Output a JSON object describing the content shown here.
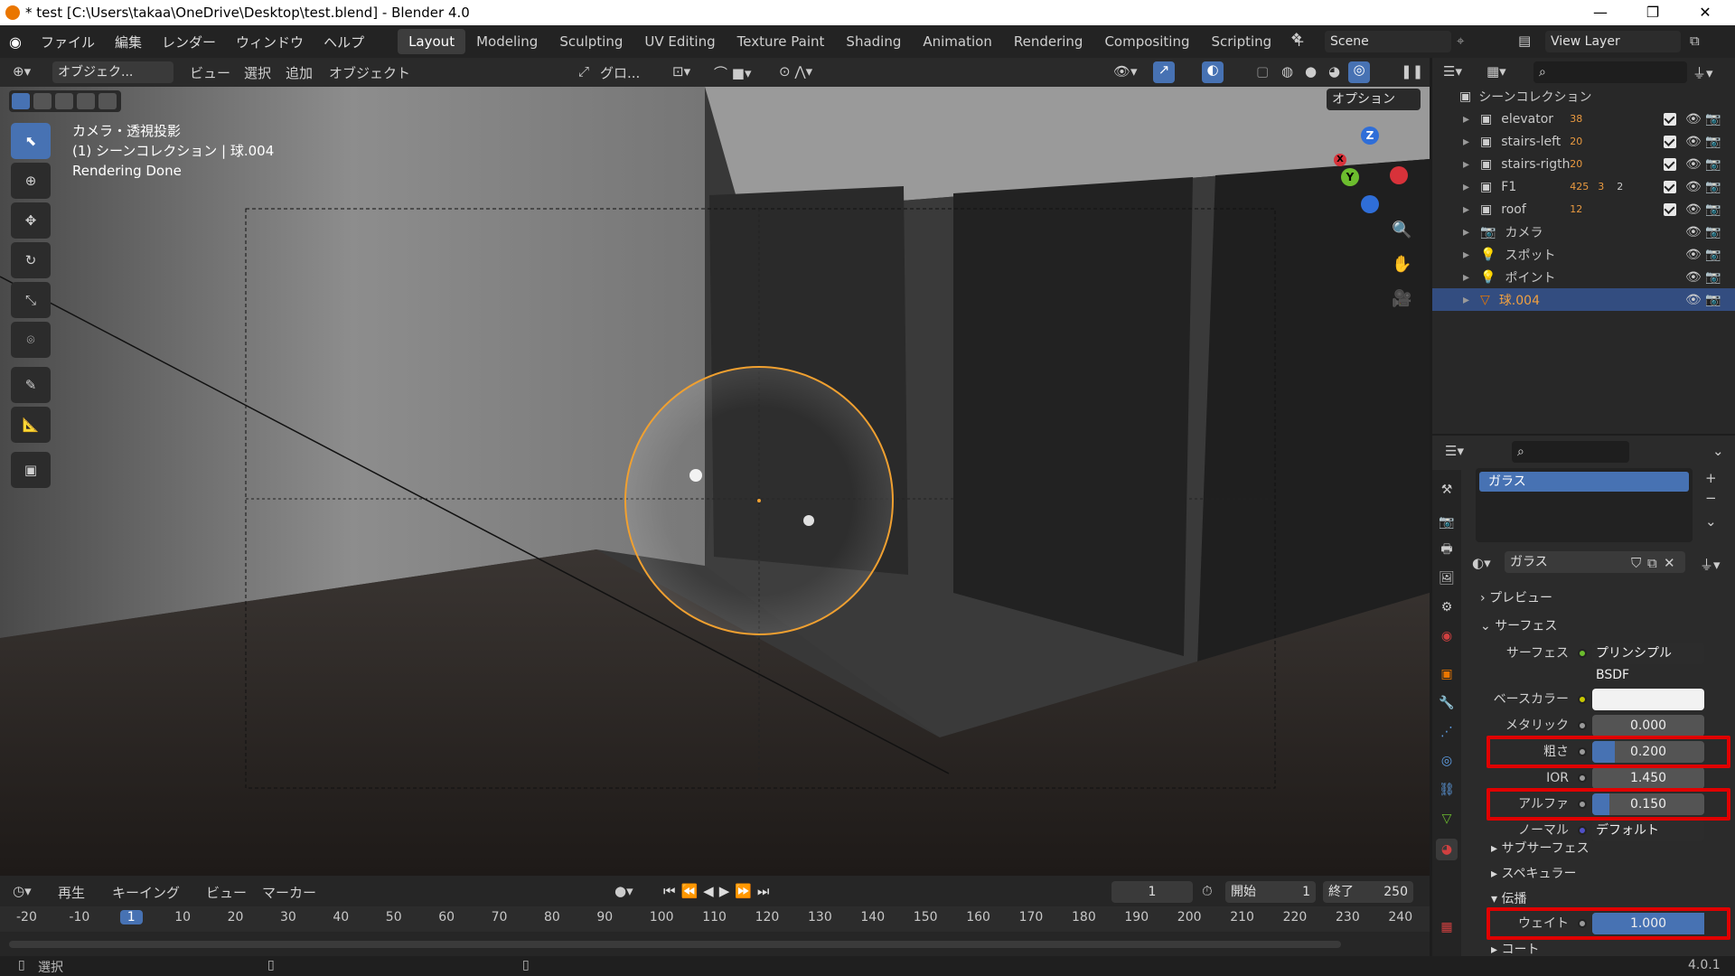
{
  "titlebar": {
    "title": "* test [C:\\Users\\takaa\\OneDrive\\Desktop\\test.blend] - Blender 4.0",
    "min": "—",
    "max": "❐",
    "close": "✕"
  },
  "menu": [
    "ファイル",
    "編集",
    "レンダー",
    "ウィンドウ",
    "ヘルプ"
  ],
  "workspaces": [
    "Layout",
    "Modeling",
    "Sculpting",
    "UV Editing",
    "Texture Paint",
    "Shading",
    "Animation",
    "Rendering",
    "Compositing",
    "Scripting",
    "+"
  ],
  "scene": "Scene",
  "view_layer": "View Layer",
  "vheader": {
    "mode": "オブジェク...",
    "view": "ビュー",
    "select": "選択",
    "add": "追加",
    "object": "オブジェクト",
    "orient": "グロ...",
    "options": "オプション"
  },
  "viewport": {
    "line1": "カメラ・透視投影",
    "line2": "(1) シーンコレクション | 球.004",
    "line3": "Rendering Done"
  },
  "gizmo": {
    "x": "X",
    "y": "Y",
    "z": "Z"
  },
  "outliner": {
    "root": "シーンコレクション",
    "items": [
      {
        "name": "elevator",
        "count": "38",
        "check": true
      },
      {
        "name": "stairs-left",
        "count": "20",
        "check": true
      },
      {
        "name": "stairs-rigth",
        "count": "20",
        "check": true
      },
      {
        "name": "F1",
        "count": "425",
        "count2": "3",
        "count3": "2",
        "check": true
      },
      {
        "name": "roof",
        "count": "12",
        "check": true
      },
      {
        "name": "カメラ",
        "count": "",
        "check": false
      },
      {
        "name": "スポット",
        "count": "",
        "check": false
      },
      {
        "name": "ポイント",
        "count": "",
        "check": false
      },
      {
        "name": "球.004",
        "count": "",
        "check": false
      }
    ]
  },
  "material": {
    "slot": "ガラス",
    "name": "ガラス",
    "preview": "プレビュー",
    "surface_section": "サーフェス",
    "surface_label": "サーフェス",
    "surface_shader": "プリンシプルBSDF",
    "props": [
      {
        "label": "ベースカラー",
        "value": "",
        "fill": 0,
        "kind": "color"
      },
      {
        "label": "メタリック",
        "value": "0.000",
        "fill": 0
      },
      {
        "label": "粗さ",
        "value": "0.200",
        "fill": 0.2
      },
      {
        "label": "IOR",
        "value": "1.450",
        "fill": 0
      },
      {
        "label": "アルファ",
        "value": "0.150",
        "fill": 0.15
      },
      {
        "label": "ノーマル",
        "value": "デフォルト",
        "fill": 0,
        "kind": "link"
      }
    ],
    "sub1": "サブサーフェス",
    "sub2": "スペキュラー",
    "sub3": "伝播",
    "weight_label": "ウェイト",
    "weight_value": "1.000",
    "weight_fill": 1.0,
    "sub4": "コート"
  },
  "timeline": {
    "play": "再生",
    "keying": "キーイング",
    "view": "ビュー",
    "marker": "マーカー",
    "current": "1",
    "start_label": "開始",
    "start": "1",
    "end_label": "終了",
    "end": "250",
    "ticks": [
      "-20",
      "-10",
      "1",
      "10",
      "20",
      "30",
      "40",
      "50",
      "60",
      "70",
      "80",
      "90",
      "100",
      "110",
      "120",
      "130",
      "140",
      "150",
      "160",
      "170",
      "180",
      "190",
      "200",
      "210",
      "220",
      "230",
      "240"
    ]
  },
  "status": {
    "select": "選択",
    "version": "4.0.1"
  }
}
